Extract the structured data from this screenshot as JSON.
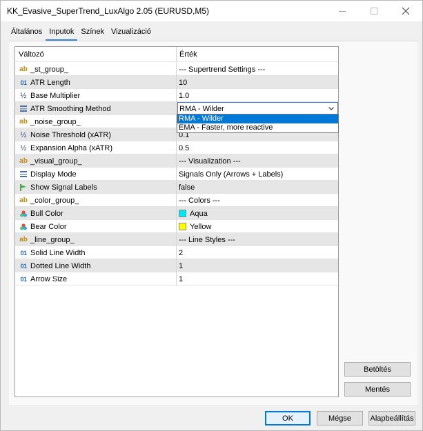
{
  "window": {
    "title": "KK_Evasive_SuperTrend_LuxAlgo 2.05 (EURUSD,M5)"
  },
  "tabs": [
    {
      "label": "Általános"
    },
    {
      "label": "Inputok"
    },
    {
      "label": "Színek"
    },
    {
      "label": "Vizualizáció"
    }
  ],
  "table": {
    "headers": {
      "variable": "Változó",
      "value": "Érték"
    },
    "rows": [
      {
        "icon": "string-ab-icon",
        "name": "_st_group_",
        "value": "--- Supertrend Settings ---"
      },
      {
        "icon": "integer-icon",
        "name": "ATR Length",
        "value": "10"
      },
      {
        "icon": "double-icon",
        "name": "Base Multiplier",
        "value": "1.0"
      },
      {
        "icon": "enum-icon",
        "name": "ATR Smoothing Method",
        "value": "RMA  - Wilder"
      },
      {
        "icon": "string-ab-icon",
        "name": "_noise_group_",
        "value": ""
      },
      {
        "icon": "double-icon",
        "name": "Noise Threshold (xATR)",
        "value": "0.1"
      },
      {
        "icon": "double-icon",
        "name": "Expansion Alpha (xATR)",
        "value": "0.5"
      },
      {
        "icon": "string-ab-icon",
        "name": "_visual_group_",
        "value": "--- Visualization ---"
      },
      {
        "icon": "enum-icon",
        "name": "Display Mode",
        "value": "Signals Only (Arrows + Labels)"
      },
      {
        "icon": "bool-icon",
        "name": "Show Signal Labels",
        "value": "false"
      },
      {
        "icon": "string-ab-icon",
        "name": "_color_group_",
        "value": "--- Colors ---"
      },
      {
        "icon": "color-icon",
        "name": "Bull Color",
        "value": "Aqua",
        "swatch": "#00e5ee"
      },
      {
        "icon": "color-icon",
        "name": "Bear Color",
        "value": "Yellow",
        "swatch": "#ffff00"
      },
      {
        "icon": "string-ab-icon",
        "name": "_line_group_",
        "value": "--- Line Styles ---"
      },
      {
        "icon": "integer-icon",
        "name": "Solid Line Width",
        "value": "2"
      },
      {
        "icon": "integer-icon",
        "name": "Dotted Line Width",
        "value": "1"
      },
      {
        "icon": "integer-icon",
        "name": "Arrow Size",
        "value": "1"
      }
    ]
  },
  "dropdown": {
    "options": [
      {
        "label": "RMA  - Wilder",
        "selected": true
      },
      {
        "label": "EMA  - Faster, more reactive",
        "selected": false
      }
    ]
  },
  "buttons": {
    "load": "Betöltés",
    "save": "Mentés",
    "ok": "OK",
    "cancel": "Mégse",
    "reset": "Alapbeállítás"
  },
  "icon_labels": {
    "ab": "ab",
    "int": "01",
    "double": "½"
  },
  "colors": {
    "accent": "#0078d7",
    "alt_row": "#e6e6e6"
  }
}
